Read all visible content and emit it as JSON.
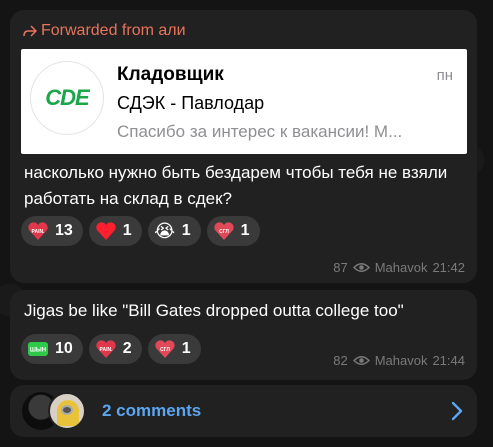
{
  "post1": {
    "forwarded_label": "Forwarded from али",
    "preview": {
      "logo_text": "CDE",
      "title": "Кладовщик",
      "date": "пн",
      "subtitle": "СДЭК - Павлодар",
      "text": "Спасибо за интерес к вакансии! М..."
    },
    "text": "насколько нужно быть бездарем чтобы тебя не взяли работать на склад в сдек?",
    "reactions": [
      {
        "label": "PAIN.",
        "count": "13"
      },
      {
        "label": "❤",
        "count": "1"
      },
      {
        "label": "😭",
        "count": "1"
      },
      {
        "label": "СГЛ",
        "count": "1"
      }
    ],
    "views": "87",
    "author": "Mahavok",
    "time": "21:42"
  },
  "post2": {
    "text": "Jigas be like \"Bill Gates dropped outta college too\"",
    "reactions": [
      {
        "label": "ШЫН",
        "count": "10"
      },
      {
        "label": "PAIN.",
        "count": "2"
      },
      {
        "label": "СГЛ",
        "count": "1"
      }
    ],
    "views": "82",
    "author": "Mahavok",
    "time": "21:44"
  },
  "comments": {
    "label": "2 comments"
  },
  "colors": {
    "accent_link": "#5aa6f0",
    "forwarded": "#e8745c",
    "bubble": "#212121",
    "reaction_bg": "#3a3a3a"
  }
}
